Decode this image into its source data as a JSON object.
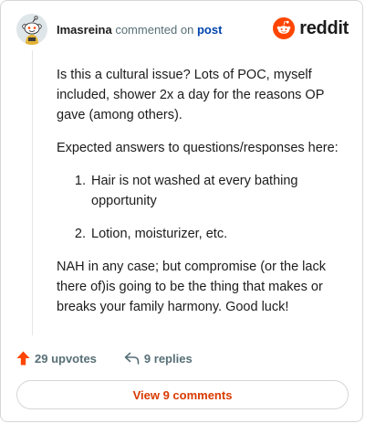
{
  "header": {
    "username": "Imasreina",
    "commented_on": "commented on",
    "post_link": "post",
    "brand": "reddit"
  },
  "comment": {
    "paragraph_1": "Is this a cultural issue? Lots of POC, myself included, shower 2x a day for the reasons OP gave (among others).",
    "paragraph_2": "Expected answers to questions/responses here:",
    "list_items": [
      "Hair is not washed at every bathing opportunity",
      "Lotion, moisturizer, etc."
    ],
    "paragraph_3": "NAH in any case; but compromise (or the lack there of)is going to be the thing that makes or breaks your family harmony. Good luck!"
  },
  "actions": {
    "upvotes": "29 upvotes",
    "replies": "9 replies"
  },
  "footer": {
    "view_comments": "View 9 comments"
  },
  "icons": {
    "upvote": "upvote-arrow-icon",
    "reply": "reply-arrow-icon",
    "avatar": "snoo-avatar-icon",
    "brand_logo": "reddit-snoo-logo-icon"
  },
  "colors": {
    "accent": "#ff4500",
    "link": "#0045ac",
    "muted": "#576f76",
    "view_comments": "#d93a00"
  }
}
